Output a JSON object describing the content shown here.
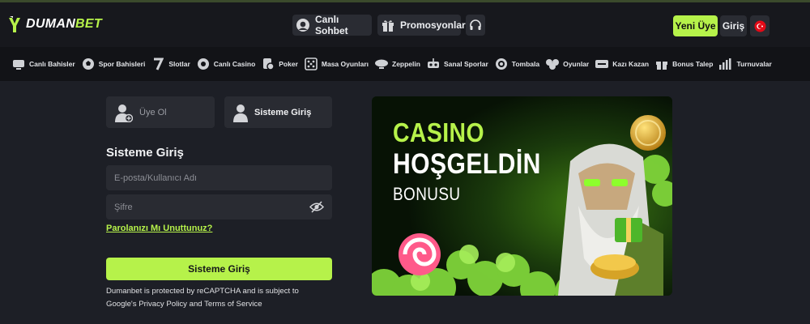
{
  "brand": {
    "name_part1": "DUMAN",
    "name_part2": "BET",
    "accent": "#b6f24a"
  },
  "header": {
    "chat_label": "Canlı Sohbet",
    "promo_label": "Promosyonlar",
    "register_label": "Yeni Üye",
    "login_label": "Giriş",
    "language_flag": "turkey-flag-icon"
  },
  "nav": {
    "items": [
      {
        "label": "Canlı Bahisler",
        "icon": "live-betting-icon"
      },
      {
        "label": "Spor Bahisleri",
        "icon": "soccer-ball-icon"
      },
      {
        "label": "Slotlar",
        "icon": "slot-seven-icon"
      },
      {
        "label": "Canlı Casino",
        "icon": "live-casino-icon"
      },
      {
        "label": "Poker",
        "icon": "poker-chip-icon"
      },
      {
        "label": "Masa Oyunları",
        "icon": "table-games-icon"
      },
      {
        "label": "Zeppelin",
        "icon": "zeppelin-icon"
      },
      {
        "label": "Sanal Sporlar",
        "icon": "virtual-sports-icon"
      },
      {
        "label": "Tombala",
        "icon": "tombala-icon"
      },
      {
        "label": "Oyunlar",
        "icon": "games-icon"
      },
      {
        "label": "Kazı Kazan",
        "icon": "scratch-card-icon"
      },
      {
        "label": "Bonus Talep",
        "icon": "gift-icon"
      },
      {
        "label": "Turnuvalar",
        "icon": "bar-chart-icon"
      }
    ]
  },
  "auth": {
    "tab_register": "Üye Ol",
    "tab_login": "Sisteme Giriş",
    "form_title": "Sisteme Giriş",
    "email_placeholder": "E-posta/Kullanıcı Adı",
    "password_placeholder": "Şifre",
    "forgot_label": "Parolanızı Mı Unuttunuz?",
    "submit_label": "Sisteme Giriş",
    "captcha_line1": "Dumanbet is protected by reCAPTCHA and is subject to",
    "captcha_line2": "Google's Privacy Policy and Terms of Service"
  },
  "banner": {
    "line1": "CASINO",
    "line2": "HOŞGELDİN",
    "line3": "BONUSU"
  }
}
